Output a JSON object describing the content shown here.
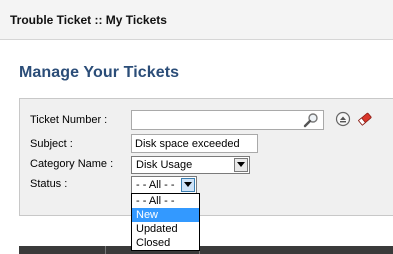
{
  "titlebar": {
    "title": "Trouble Ticket :: My Tickets"
  },
  "page": {
    "heading": "Manage Your Tickets"
  },
  "form": {
    "ticket_number": {
      "label": "Ticket Number :",
      "value": ""
    },
    "subject": {
      "label": "Subject :",
      "value": "Disk space exceeded"
    },
    "category": {
      "label": "Category Name :",
      "selected": "Disk Usage"
    },
    "status": {
      "label": "Status :",
      "selected": "- - All - -",
      "options": [
        "- - All - -",
        "New",
        "Updated",
        "Closed"
      ],
      "highlighted": "New"
    }
  },
  "icons": {
    "search": "magnifier-icon",
    "eject": "eject-icon",
    "clear": "eraser-icon"
  },
  "colors": {
    "heading": "#2b4d78",
    "highlight": "#3399ff",
    "panel": "#f0f0f0"
  }
}
